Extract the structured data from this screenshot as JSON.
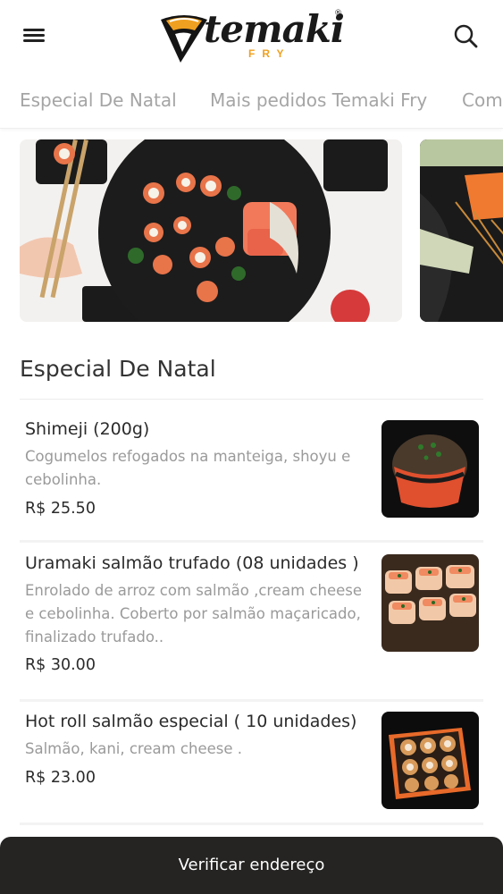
{
  "header": {
    "logo_text": "temaki",
    "logo_sub": "FRY",
    "logo_reg": "®",
    "menu_icon": "hamburger-menu-icon",
    "search_icon": "search-icon"
  },
  "tabs": [
    {
      "label": "Especial De Natal"
    },
    {
      "label": "Mais pedidos Temaki Fry"
    },
    {
      "label": "Com"
    }
  ],
  "banners": [
    {
      "description": "sushi platter with chopsticks"
    },
    {
      "description": "sushi rolls with salmon"
    }
  ],
  "section": {
    "title": "Especial De Natal"
  },
  "items": [
    {
      "name": "Shimeji (200g)",
      "description_lines": [
        "Cogumelos refogados na manteiga, shoyu e",
        "cebolinha."
      ],
      "price": "R$ 25.50"
    },
    {
      "name": "Uramaki salmão trufado (08 unidades )",
      "description_lines": [
        "Enrolado de arroz com salmão ,cream cheese",
        "e cebolinha. Coberto por salmão maçaricado,",
        "finalizado trufado.."
      ],
      "price": "R$ 30.00"
    },
    {
      "name": "Hot roll salmão especial ( 10 unidades)",
      "description_lines": [
        "Salmão, kani, cream cheese ."
      ],
      "price": "R$ 23.00"
    }
  ],
  "bottom_bar": {
    "label": "Verificar endereço"
  },
  "colors": {
    "accent": "#f0a020",
    "bottom_bar": "#252423",
    "tab_text": "#a5a5a5",
    "desc_text": "#9a9a9a"
  }
}
